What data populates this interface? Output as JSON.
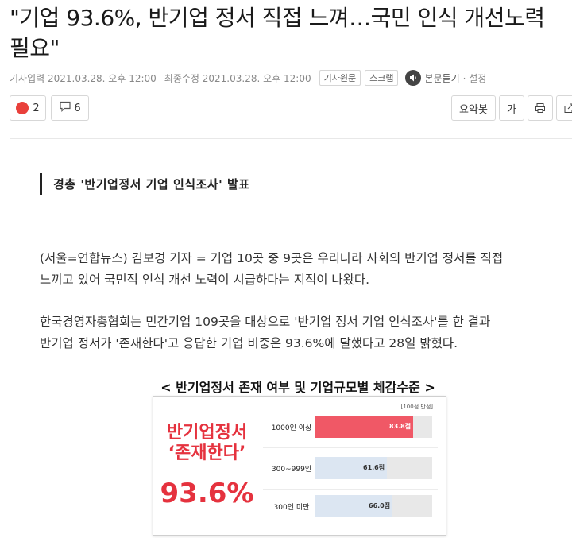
{
  "article": {
    "headline_lines": [
      "\"기업 93.6%, 반기업 정서 직접 느껴…국민 인식 개선노력",
      "필요\""
    ],
    "meta": {
      "published": "기사입력 2021.03.28. 오후 12:00",
      "modified": "최종수정 2021.03.28. 오후 12:00",
      "original_button": "기사원문",
      "scrap_button": "스크랩",
      "listen_label": "본문듣기",
      "settings_label": "· 설정"
    },
    "actions": {
      "reaction_count": "2",
      "comment_count": "6",
      "summary_label": "요약봇",
      "font_label": "가"
    },
    "subtitle": "경총 '반기업정서 기업 인식조사' 발표",
    "paragraphs": [
      [
        "(서울=연합뉴스) 김보경 기자 = 기업 10곳 중 9곳은 우리나라 사회의 반기업 정서를 직접",
        "느끼고 있어 국민적 인식 개선 노력이 시급하다는 지적이 나왔다."
      ],
      [
        "한국경영자총협회는 민간기업 109곳을 대상으로 '반기업 정서 기업 인식조사'를 한 결과",
        "반기업 정서가 '존재한다'고 응답한 기업 비중은 93.6%에 달했다고 28일 밝혔다."
      ]
    ]
  },
  "figure": {
    "title": "< 반기업정서 존재 여부 및 기업규모별 체감수준 >",
    "left_label_lines": [
      "반기업정서",
      "‘존재한다’"
    ],
    "left_value": "93.6%",
    "note": "[100점 만점]"
  },
  "chart_data": {
    "type": "bar",
    "orientation": "horizontal",
    "categories": [
      "1000인 이상",
      "300~999인",
      "300인 미만"
    ],
    "values": [
      83.8,
      61.6,
      66.0
    ],
    "value_labels": [
      "83.8점",
      "61.6점",
      "66.0점"
    ],
    "xlim": [
      0,
      100
    ],
    "colors": {
      "highlight": "#f05866",
      "normal": "#dce6f2",
      "track": "#e8e8e8"
    }
  }
}
